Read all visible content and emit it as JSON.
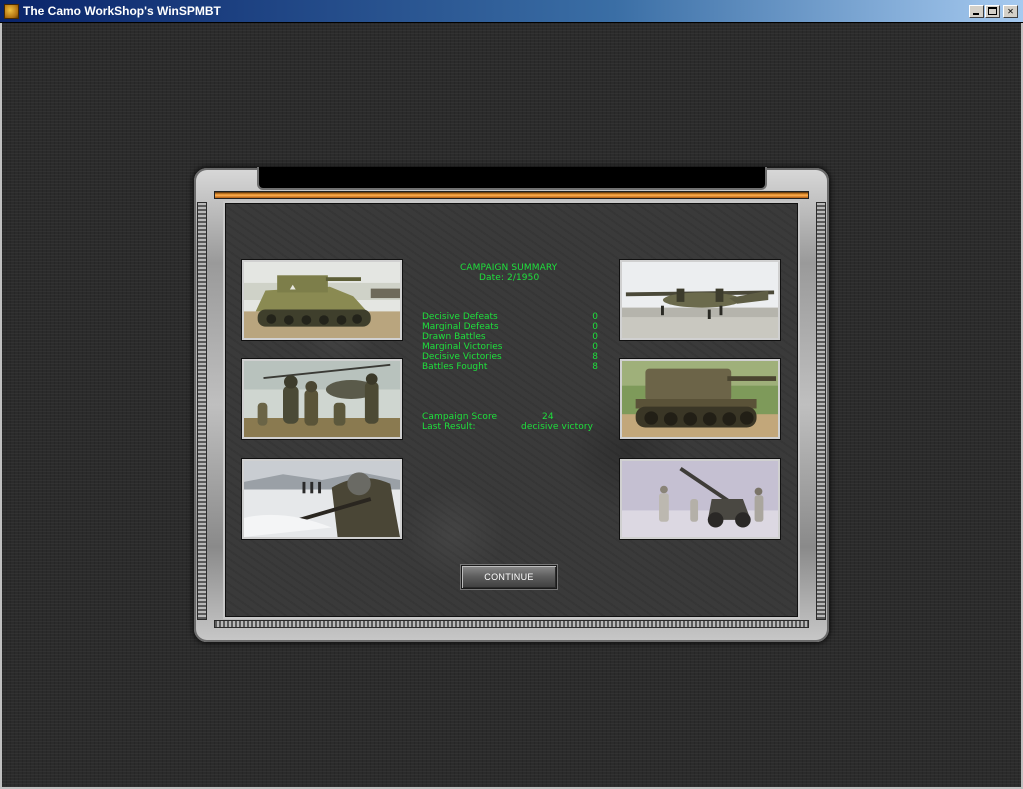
{
  "window": {
    "title": "The Camo WorkShop's WinSPMBT"
  },
  "summary": {
    "title": "CAMPAIGN SUMMARY",
    "date": "Date: 2/1950",
    "stats": [
      {
        "label": "Decisive Defeats",
        "value": "0"
      },
      {
        "label": "Marginal Defeats",
        "value": "0"
      },
      {
        "label": "Drawn Battles",
        "value": "0"
      },
      {
        "label": "Marginal Victories",
        "value": "0"
      },
      {
        "label": "Decisive Victories",
        "value": "8"
      },
      {
        "label": "Battles Fought",
        "value": "8"
      }
    ],
    "score_label": "Campaign Score",
    "score_value": "24",
    "result_label": "Last Result:",
    "result_value": "decisive victory"
  },
  "buttons": {
    "continue": "CONTINUE"
  },
  "photos": [
    {
      "name": "photo-self-propelled-gun"
    },
    {
      "name": "photo-soldiers-helicopter"
    },
    {
      "name": "photo-winter-soldier"
    },
    {
      "name": "photo-cargo-plane"
    },
    {
      "name": "photo-tracked-artillery"
    },
    {
      "name": "photo-howitzer-crew"
    }
  ],
  "colors": {
    "summary_text": "#1ee03c",
    "accent_bar": "#e08a2a"
  }
}
